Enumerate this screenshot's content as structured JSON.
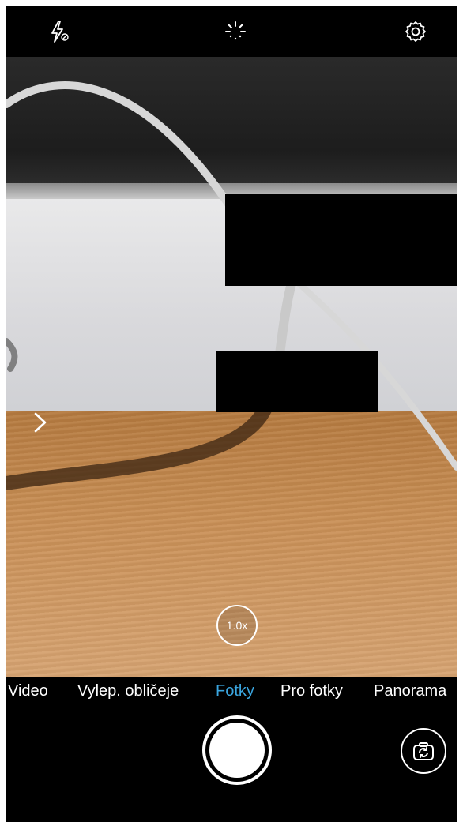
{
  "app": "camera",
  "top_bar": {
    "flash_icon": "flash-off-icon",
    "live_photo_icon": "live-photo-icon",
    "settings_icon": "gear-icon"
  },
  "viewfinder": {
    "side_panel_icon": "chevron-right-icon",
    "zoom_label": "1.0x"
  },
  "modes": {
    "items": [
      {
        "label": "Video"
      },
      {
        "label": "Vylep. obličeje"
      },
      {
        "label": "Fotky"
      },
      {
        "label": "Pro fotky"
      },
      {
        "label": "Panorama"
      }
    ],
    "active_index": 2,
    "active_color": "#3aa6e0"
  },
  "controls": {
    "shutter_icon": "shutter-button",
    "switch_camera_icon": "camera-switch-icon"
  }
}
